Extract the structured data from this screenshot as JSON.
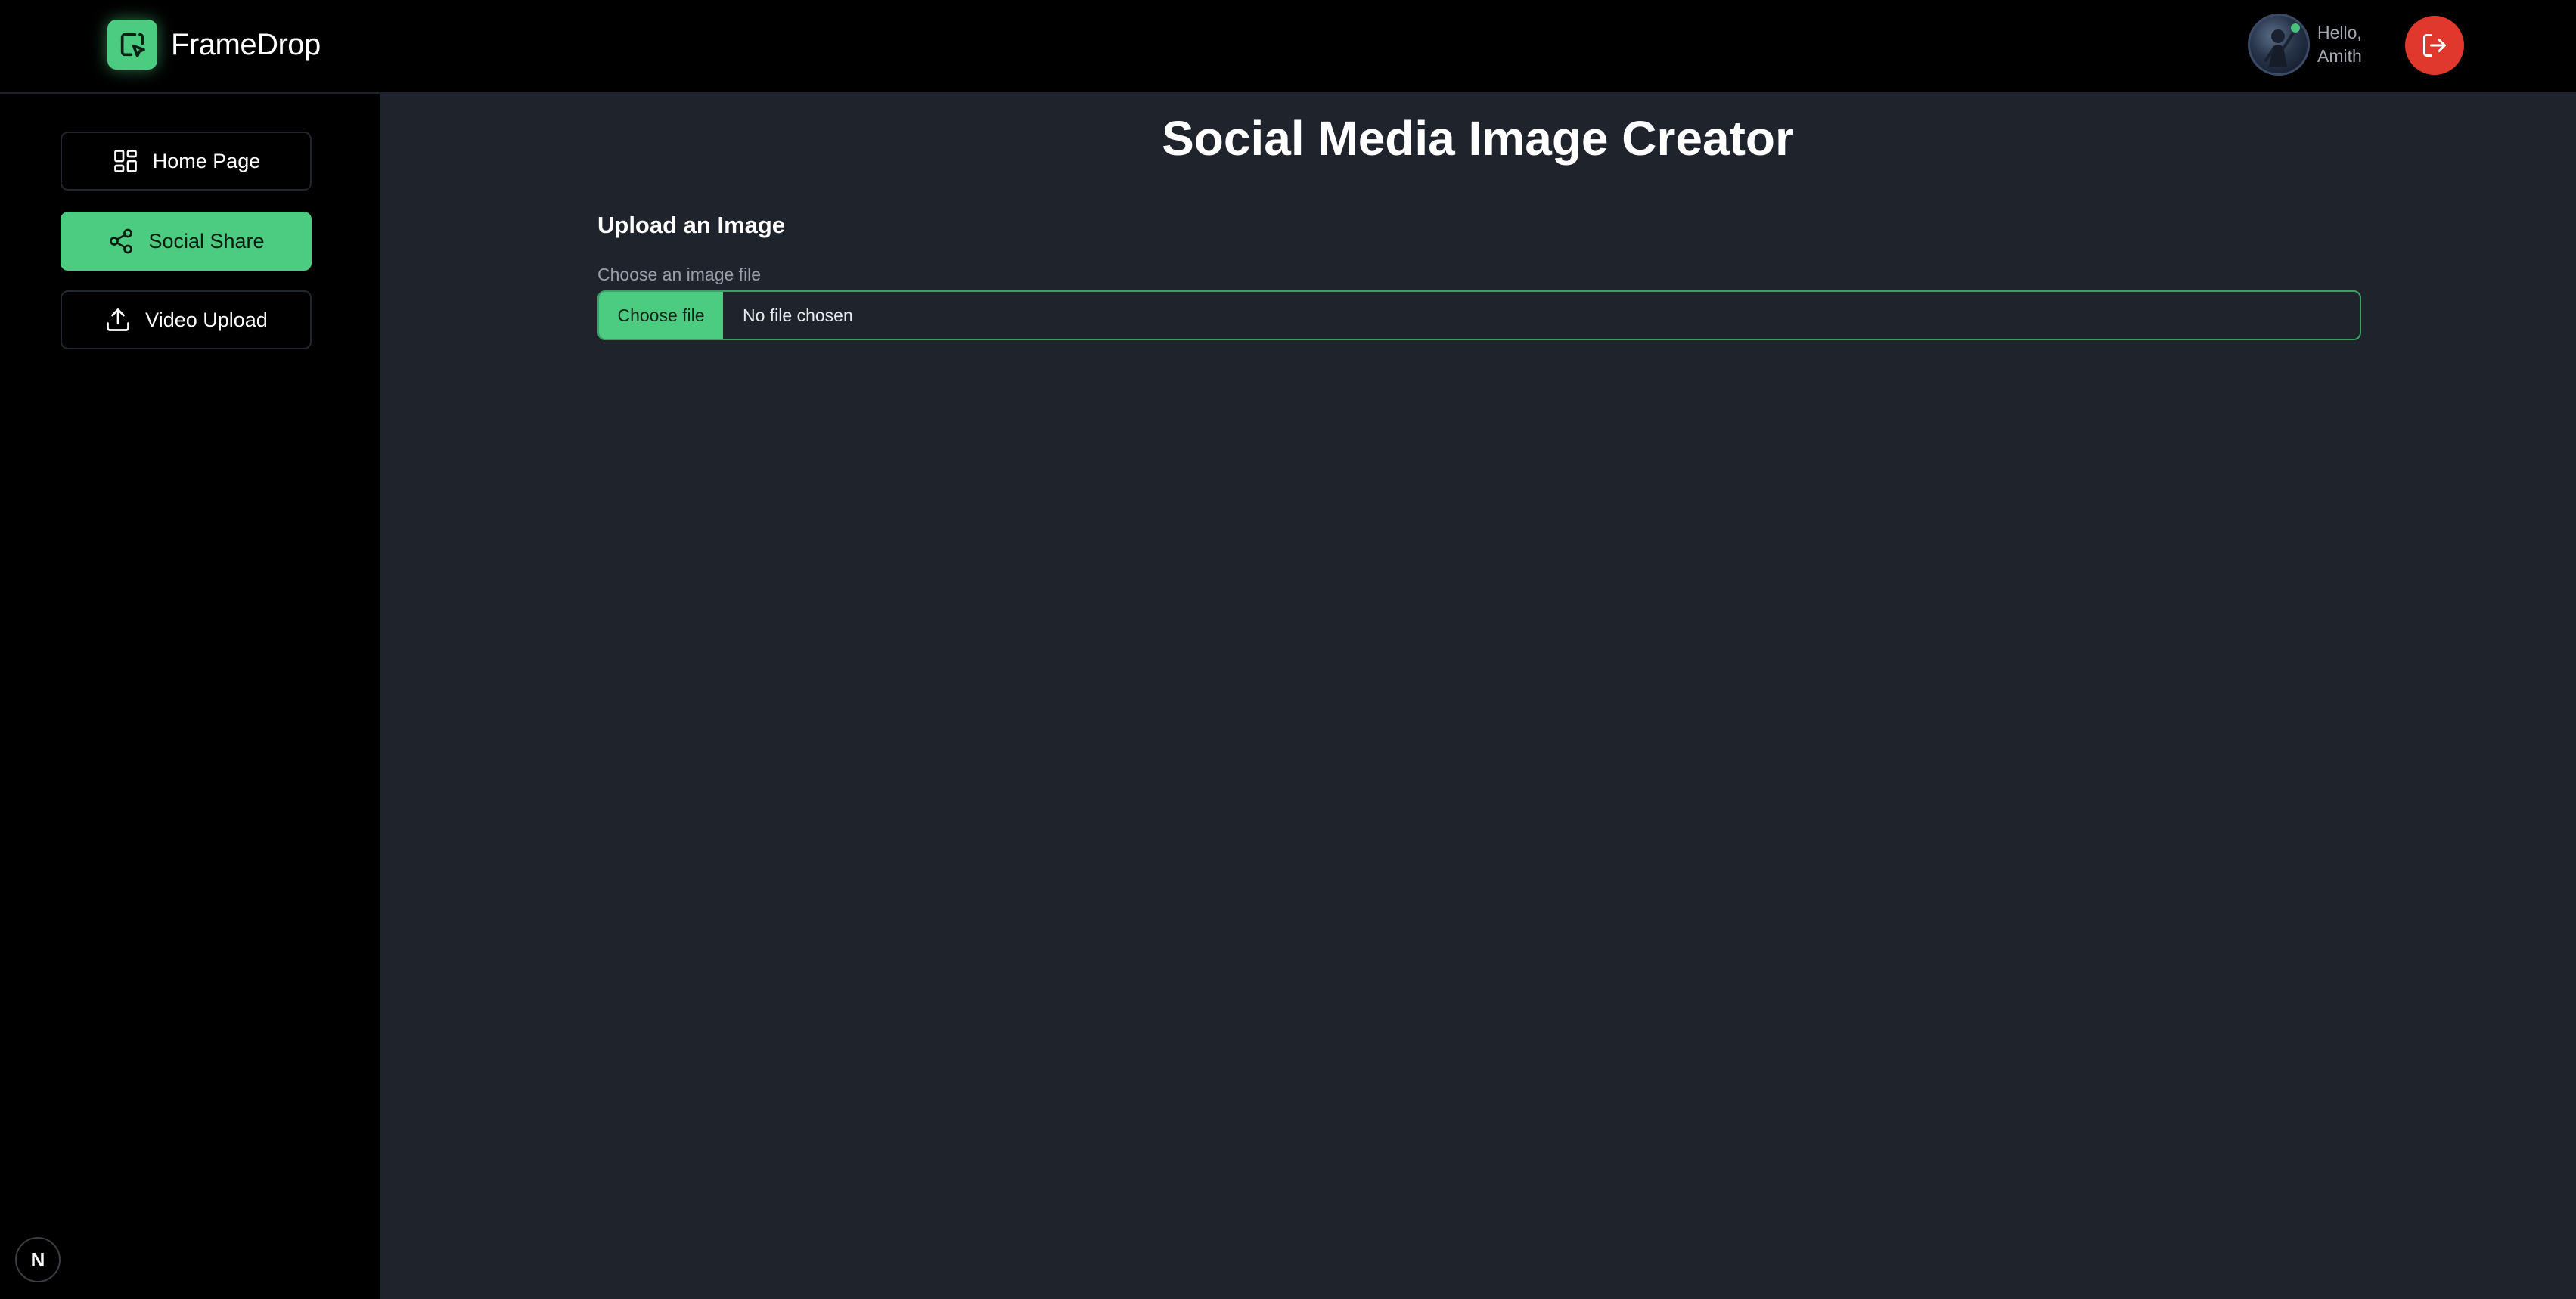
{
  "header": {
    "brand_name": "FrameDrop",
    "logo_icon": "framedrop-logo-icon",
    "greeting_line1": "Hello,",
    "greeting_line2": "Amith",
    "logout_icon": "logout-icon"
  },
  "sidebar": {
    "items": [
      {
        "label": "Home Page",
        "icon": "dashboard-grid-icon",
        "active": false
      },
      {
        "label": "Social Share",
        "icon": "share-icon",
        "active": true
      },
      {
        "label": "Video Upload",
        "icon": "upload-icon",
        "active": false
      }
    ],
    "badge_letter": "N"
  },
  "main": {
    "title": "Social Media Image Creator",
    "section_title": "Upload an Image",
    "field_label": "Choose an image file",
    "choose_button": "Choose file",
    "file_status": "No file chosen"
  },
  "colors": {
    "accent": "#4ccc80",
    "logout": "#e0382c",
    "main_bg": "#1f232b",
    "sidebar_bg": "#000000"
  }
}
